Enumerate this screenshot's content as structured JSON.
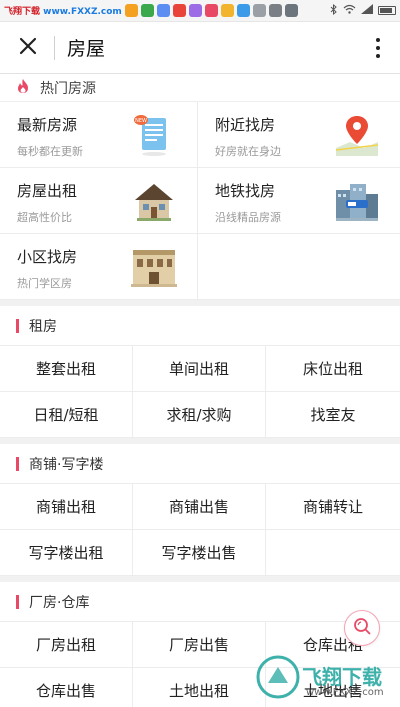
{
  "statusbar": {
    "brand_prefix": "飞翔下载",
    "brand_url": "www.FXXZ.com",
    "app_colors": [
      "#f4a020",
      "#3aa84b",
      "#5b8df2",
      "#e8443a",
      "#9b6ce6",
      "#e84a66",
      "#f2b32e",
      "#3b9be8",
      "#9aa0a6",
      "#7a7f86",
      "#6c757d"
    ],
    "status_icons": [
      "bluetooth-icon",
      "wifi-icon",
      "signal-icon",
      "battery-icon"
    ]
  },
  "topbar": {
    "close_icon": "close-icon",
    "title": "房屋",
    "more_icon": "more-vertical-icon"
  },
  "hot": {
    "header": "热门房源",
    "icon": "flame-icon",
    "items": [
      {
        "title": "最新房源",
        "subtitle": "每秒都在更新",
        "icon": "new-listing-icon"
      },
      {
        "title": "附近找房",
        "subtitle": "好房就在身边",
        "icon": "map-pin-icon"
      },
      {
        "title": "房屋出租",
        "subtitle": "超高性价比",
        "icon": "house-icon"
      },
      {
        "title": "地铁找房",
        "subtitle": "沿线精品房源",
        "icon": "subway-icon"
      },
      {
        "title": "小区找房",
        "subtitle": "热门学区房",
        "icon": "community-building-icon"
      }
    ]
  },
  "rent": {
    "header": "租房",
    "items": [
      "整套出租",
      "单间出租",
      "床位出租",
      "日租/短租",
      "求租/求购",
      "找室友"
    ]
  },
  "shop": {
    "header": "商铺·写字楼",
    "items": [
      "商铺出租",
      "商铺出售",
      "商铺转让",
      "写字楼出租",
      "写字楼出售",
      ""
    ]
  },
  "factory": {
    "header": "厂房·仓库",
    "items": [
      "厂房出租",
      "厂房出售",
      "仓库出租",
      "仓库出售",
      "土地出租",
      "土地出售"
    ]
  },
  "fab": {
    "icon": "search-icon"
  },
  "watermark": {
    "text": "飞翔下载",
    "url": "www.FXXZ.com"
  },
  "colors": {
    "accent": "#e84a66",
    "divider": "#ececec",
    "gap": "#f1f1f1"
  }
}
